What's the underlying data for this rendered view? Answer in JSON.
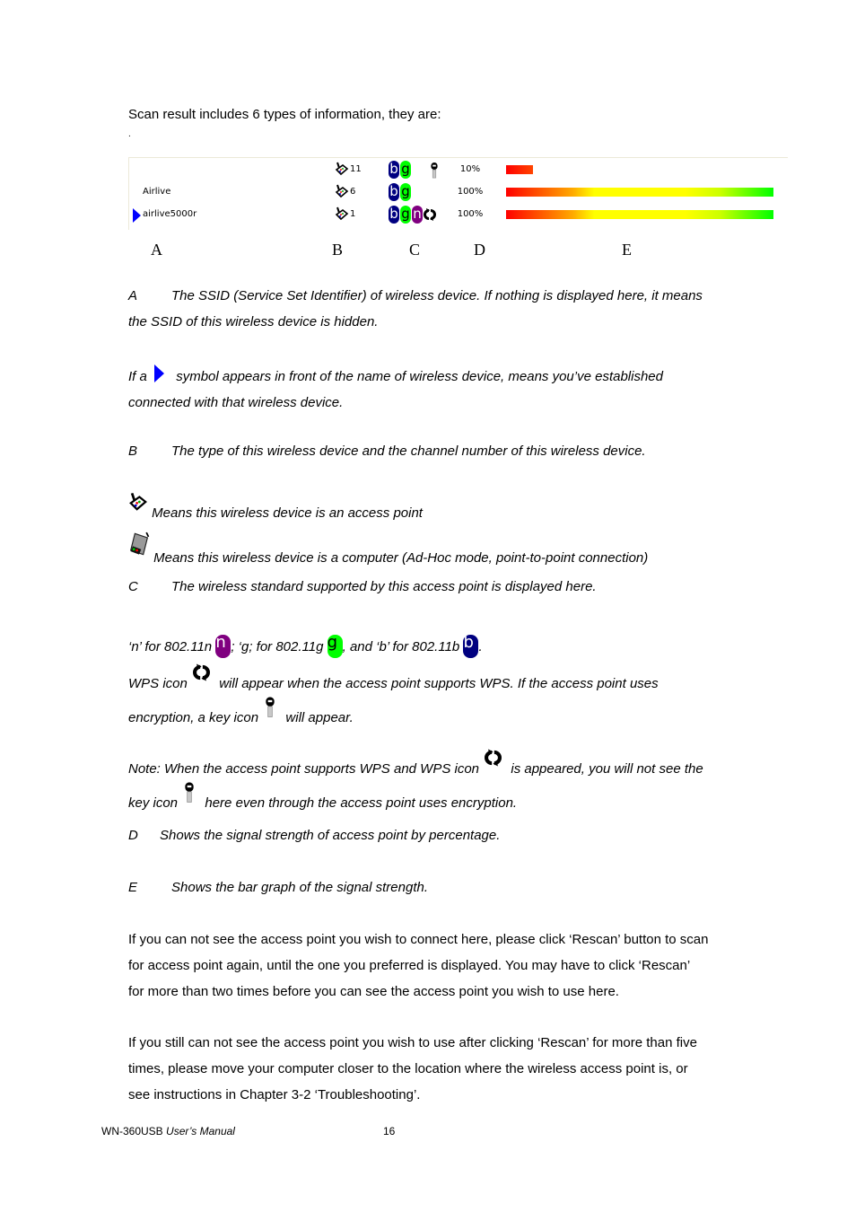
{
  "intro": "Scan result includes 6 types of information, they are:",
  "stray_mark": ".",
  "scan_panel": {
    "rows": [
      {
        "ssid": "",
        "connected": false,
        "device_type": "access-point",
        "channel": "11",
        "standards": [
          "b",
          "g"
        ],
        "wps": false,
        "encrypted": true,
        "signal_label": "10%",
        "signal_percent": 10
      },
      {
        "ssid": "Airlive",
        "connected": false,
        "device_type": "access-point",
        "channel": "6",
        "standards": [
          "b",
          "g"
        ],
        "wps": false,
        "encrypted": false,
        "signal_label": "100%",
        "signal_percent": 100
      },
      {
        "ssid": "airlive5000r",
        "connected": true,
        "device_type": "access-point",
        "channel": "1",
        "standards": [
          "b",
          "g",
          "n"
        ],
        "wps": true,
        "encrypted": false,
        "signal_label": "100%",
        "signal_percent": 100
      }
    ],
    "column_letters": [
      "A",
      "B",
      "C",
      "D",
      "E"
    ],
    "colors": {
      "b": "#000080",
      "g": "#00ff00",
      "n": "#800080",
      "connected_arrow": "#0000ff",
      "bar_gradient": [
        "#ff0000",
        "#ff6600",
        "#ffcc00",
        "#ffff00",
        "#ffff00",
        "#ccff00",
        "#00ff00"
      ]
    }
  },
  "sections": {
    "a_letter": "A",
    "a_text": "The SSID (Service Set Identifier) of wireless device. If nothing is displayed here, it means",
    "a_text2": "the SSID of this wireless device is hidden.",
    "arrow_pre": "If a",
    "arrow_post": "symbol appears in front of the name of wireless device, means you’ve established",
    "arrow_line2": "connected with that wireless device.",
    "b_letter": "B",
    "b_text": "The type of this wireless device and the channel number of this wireless device.",
    "ap_text": "Means this wireless device is an access point",
    "adhoc_text": "Means this wireless device is a computer (Ad-Hoc mode, point-to-point connection)",
    "c_letter": "C",
    "c_text": "The wireless standard supported by this access point is displayed here.",
    "std_n": "‘n’ for 802.11n",
    "std_g": "; ‘g; for 802.11g",
    "std_b": ", and ‘b’ for 802.11b",
    "std_end": ".",
    "wps_pre": "WPS icon",
    "wps_post": "will appear when the access point supports WPS. If the access point uses",
    "key_pre": "encryption, a key icon",
    "key_post": "will appear.",
    "note_pre": "Note: When the access point supports WPS and WPS icon",
    "note_post": "is appeared, you will not see the",
    "note2_pre": "key icon",
    "note2_post": "here even through the access point uses encryption.",
    "d_letter": "D",
    "d_text": "Shows the signal strength of access point by percentage.",
    "e_letter": "E",
    "e_text": "Shows the bar graph of the signal strength."
  },
  "rescan_para": [
    "If you can not see the access point you wish to connect here, please click ‘Rescan’ button to scan",
    "for access point again, until the one you preferred is displayed. You may have to click ‘Rescan’",
    "for more than two times before you can see the access point you wish to use here."
  ],
  "still_para": [
    "If you still can not see the access point you wish to use after clicking ‘Rescan’ for more than five",
    "times, please move your computer closer to the location where the wireless access point is, or",
    "see instructions in Chapter 3-2 ‘Troubleshooting’."
  ],
  "footer": {
    "product": "WN-360USB",
    "manual": "User’s Manual",
    "page": "16"
  }
}
